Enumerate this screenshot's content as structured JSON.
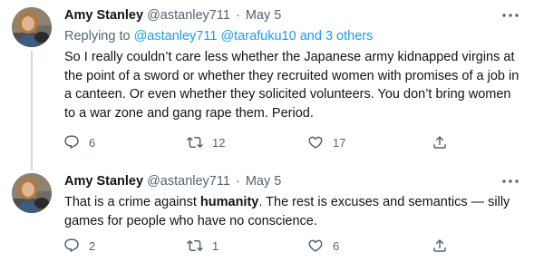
{
  "tweets": [
    {
      "name": "Amy Stanley",
      "handle": "@astanley711",
      "separator": "·",
      "date": "May 5",
      "replying_prefix": "Replying to",
      "replying_mentions": "@astanley711 @tarafuku10 and 3 others",
      "text": "So I really couldn’t care less whether the Japanese army kidnapped virgins at the point of a sword or whether they recruited women with promises of a job in a canteen. Or even whether they solicited volunteers. You don’t bring women to a war zone and gang rape them. Period.",
      "replies": "6",
      "retweets": "12",
      "likes": "17"
    },
    {
      "name": "Amy Stanley",
      "handle": "@astanley711",
      "separator": "·",
      "date": "May 5",
      "text_before": "That is a crime against ",
      "text_bold": "humanity",
      "text_after": ". The rest is excuses and semantics — silly games for people who have no conscience.",
      "replies": "2",
      "retweets": "1",
      "likes": "6"
    }
  ],
  "icons": {
    "reply": "reply-icon",
    "retweet": "retweet-icon",
    "like": "like-icon",
    "share": "share-icon",
    "more": "more-icon"
  },
  "colors": {
    "text": "#0f1419",
    "secondary": "#536471",
    "link": "#1d9bf0",
    "thread_line": "#cfd9de"
  }
}
